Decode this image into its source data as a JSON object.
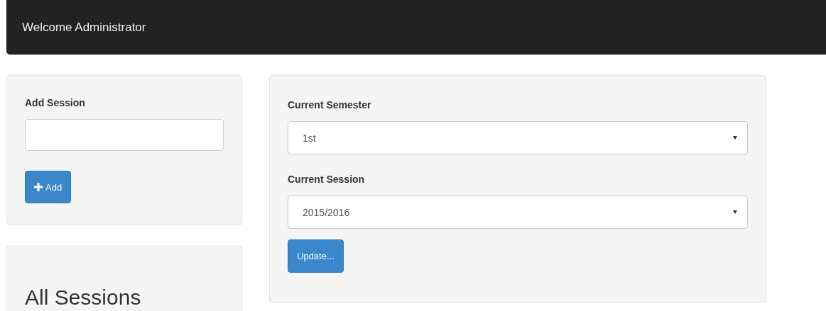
{
  "navbar": {
    "title": "Welcome Administrator"
  },
  "add_session": {
    "label": "Add Session",
    "button": "Add"
  },
  "all_sessions": {
    "title": "All Sessions"
  },
  "current": {
    "fields": [
      {
        "label": "Current Semester",
        "value": "1st"
      },
      {
        "label": "Current Session",
        "value": "2015/2016"
      }
    ],
    "button": "Update..."
  }
}
